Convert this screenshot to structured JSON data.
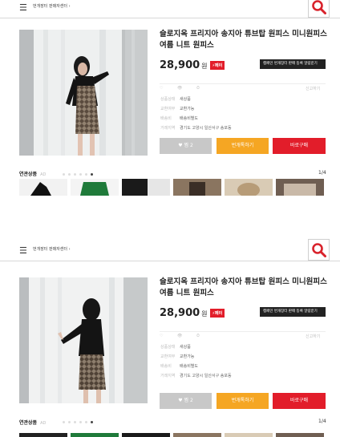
{
  "panels": [
    {
      "breadcrumb": "번개장터 판매자센터 ›",
      "title": "슬로지옥 프리지아 송지아 튜브탑 원피스 미니원피스 여름 니트 원피스",
      "price": "28,900",
      "currency": "원",
      "pay_badge": "⚡페이",
      "cafe_button": "캠페인 번개장터 판매 등록 알림받기",
      "meta": [
        "♡",
        "👁",
        "⏱",
        "신고하기"
      ],
      "info": [
        {
          "key": "상품상태",
          "value": "새상품"
        },
        {
          "key": "교환여부",
          "value": "교환가능"
        },
        {
          "key": "배송비",
          "value": "배송비별도"
        },
        {
          "key": "거래지역",
          "value": "경기도 고양시 일산서구 송포동"
        }
      ],
      "buttons": {
        "like": "♥ 찜 2",
        "talk": "번개톡하기",
        "buy": "바로구매"
      },
      "related_label": "연관상품",
      "related_count": "AD",
      "pager": "1/4"
    },
    {
      "breadcrumb": "번개장터 판매자센터 ›",
      "title": "슬로지옥 프리지아 송지아 튜브탑 원피스 미니원피스 여름 니트 원피스",
      "price": "28,900",
      "currency": "원",
      "pay_badge": "⚡페이",
      "cafe_button": "캠페인 번개장터 판매 등록 알림받기",
      "meta": [
        "♡",
        "👁",
        "⏱",
        "신고하기"
      ],
      "info": [
        {
          "key": "상품상태",
          "value": "새상품"
        },
        {
          "key": "교환여부",
          "value": "교환가능"
        },
        {
          "key": "배송비",
          "value": "배송비별도"
        },
        {
          "key": "거래지역",
          "value": "경기도 고양시 일산서구 송포동"
        }
      ],
      "buttons": {
        "like": "♥ 찜 2",
        "talk": "번개톡하기",
        "buy": "바로구매"
      },
      "related_label": "연관상품",
      "related_count": "AD",
      "pager": "1/4"
    }
  ],
  "colors": {
    "buy": "#e21d2a",
    "talk": "#f5a623",
    "like": "#c8c8c8",
    "badge": "#e21d2a"
  },
  "icons": [
    "menu-icon",
    "search-icon",
    "heart-icon",
    "eye-icon",
    "clock-icon",
    "location-pin-icon"
  ]
}
